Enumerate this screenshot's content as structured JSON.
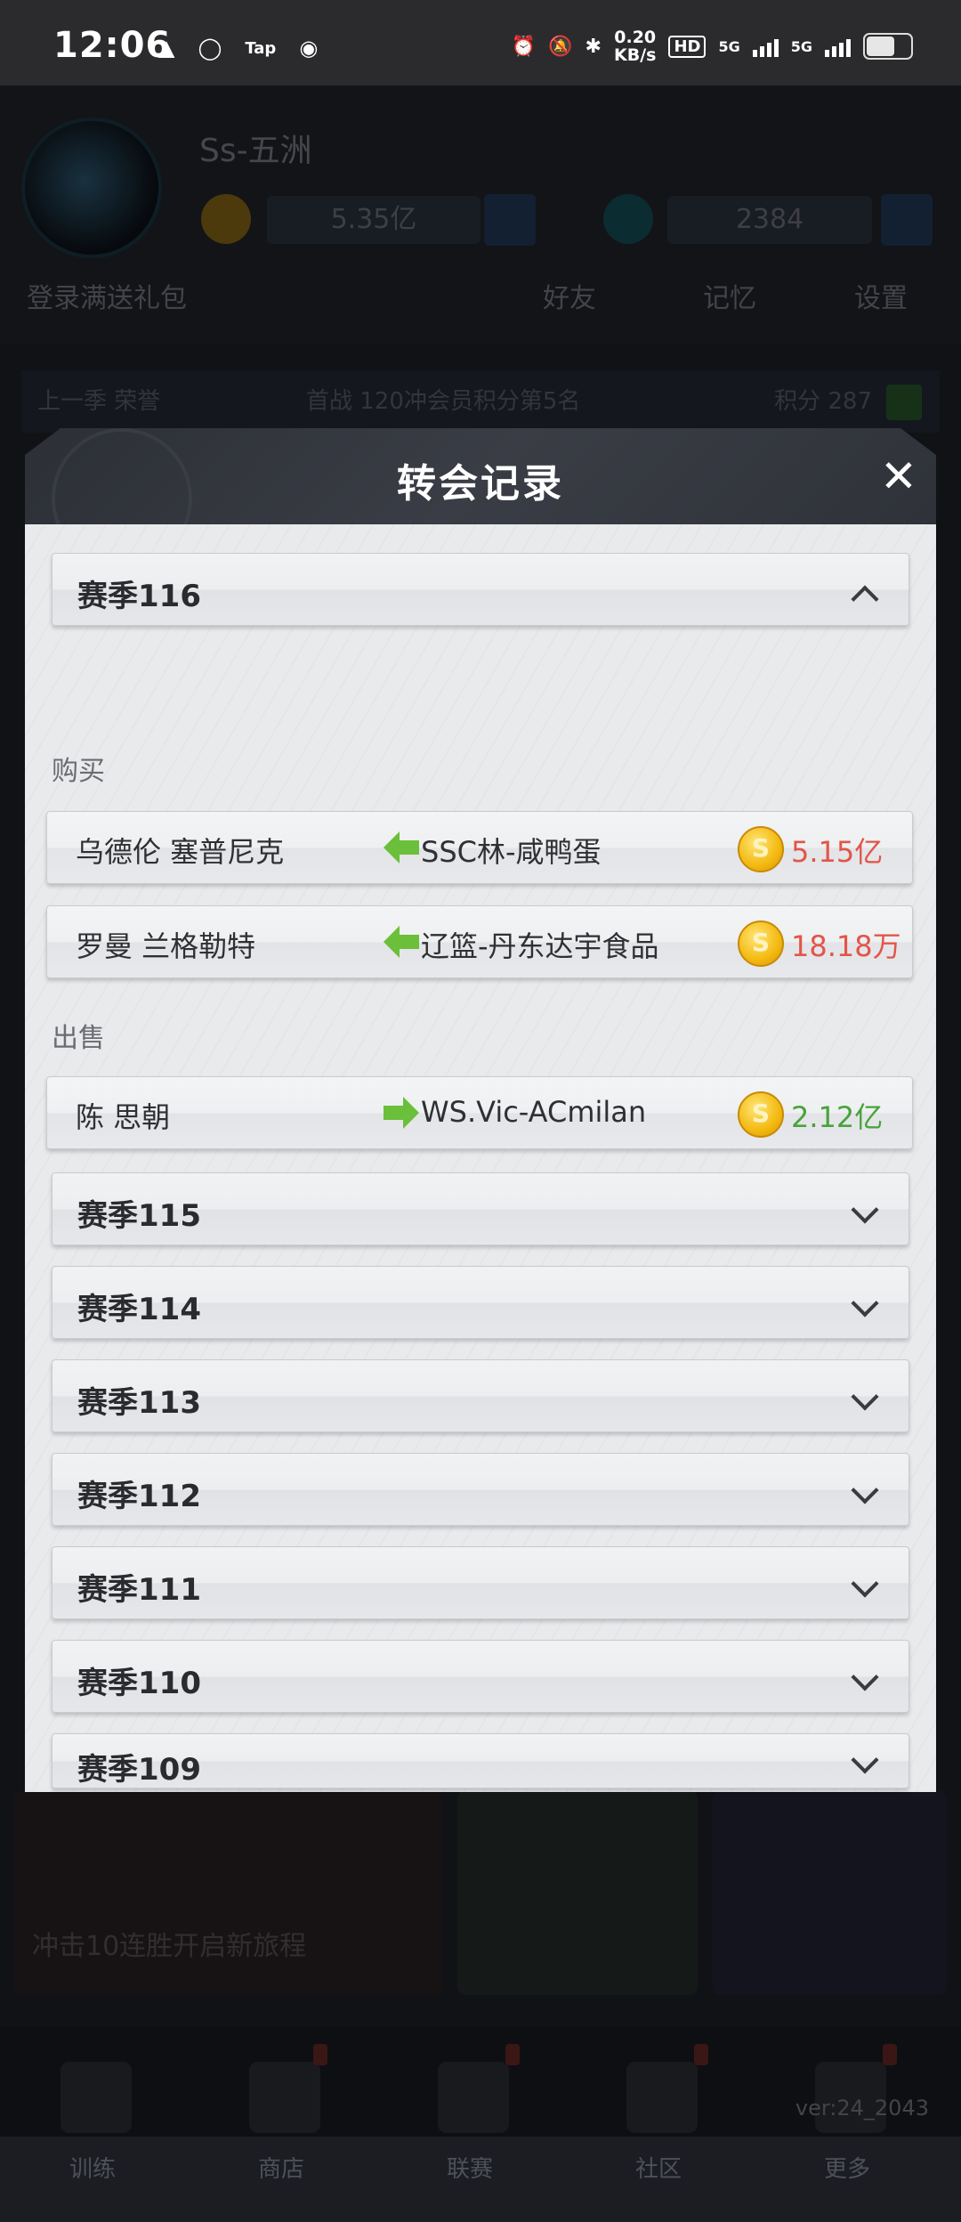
{
  "status_bar": {
    "time": "12:06",
    "left_icons": [
      "notification-icon",
      "app-icon",
      "taptap-icon",
      "cat-icon"
    ],
    "speed_value": "0.20",
    "speed_unit": "KB/s",
    "hd": "HD",
    "sim1": "5G",
    "sim2": "5G",
    "battery_level": 0.6
  },
  "background": {
    "team_name": "Ss-五洲",
    "coins": "5.35亿",
    "gems": "2384",
    "row2_left": "登录满送礼包",
    "row2_items": [
      "好友",
      "记忆",
      "设置"
    ],
    "rank_text": "上一季 荣誉",
    "rank_mid": "首战 120冲会员积分第5名",
    "rank_right": "积分 287",
    "banner_text": "冲击10连胜开启新旅程",
    "nav_labels": [
      "训练",
      "商店",
      "联赛",
      "社区",
      "更多"
    ],
    "version": "ver:24_2043"
  },
  "modal": {
    "title": "转会记录",
    "close_icon": "close-icon",
    "expanded_season": {
      "label": "赛季116",
      "buy_label": "购买",
      "sell_label": "出售",
      "buys": [
        {
          "player": "乌德伦 塞普尼克",
          "team": "SSC林-咸鸭蛋",
          "price": "5.15亿"
        },
        {
          "player": "罗曼 兰格勒特",
          "team": "辽篮-丹东达宇食品",
          "price": "18.18万"
        }
      ],
      "sells": [
        {
          "player": "陈 思朝",
          "team": "WS.Vic-ACmilan",
          "price": "2.12亿"
        }
      ]
    },
    "collapsed_seasons": [
      "赛季115",
      "赛季114",
      "赛季113",
      "赛季112",
      "赛季111",
      "赛季110",
      "赛季109"
    ],
    "colors": {
      "buy_price": "#e2554a",
      "sell_price": "#4aa23a",
      "arrow": "#6bbf3a"
    }
  }
}
